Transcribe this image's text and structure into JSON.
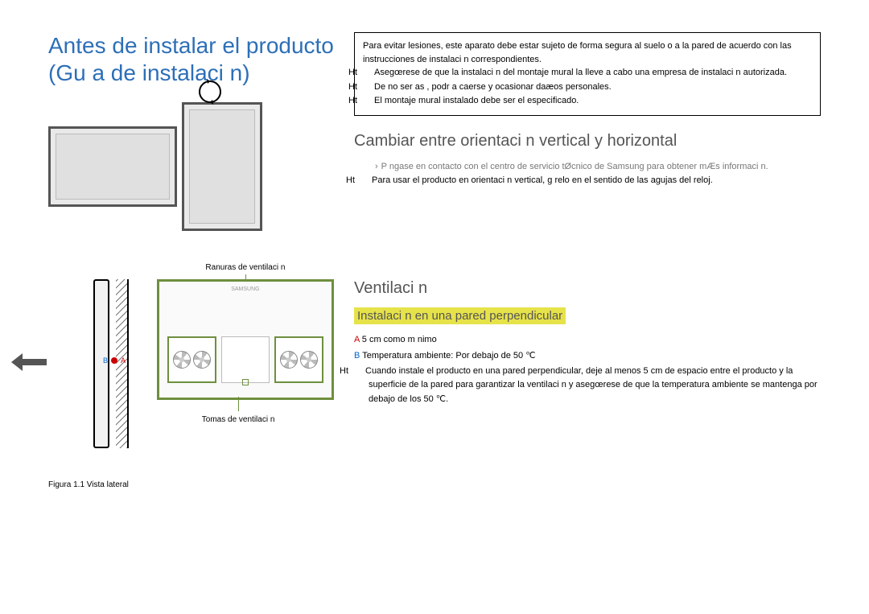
{
  "main_title": "Antes de instalar el producto (Gu a de instalaci n)",
  "warning_box": {
    "intro": "Para evitar lesiones, este aparato debe estar sujeto de forma segura al suelo o a la pared de acuerdo con las instrucciones de instalaci n correspondientes.",
    "bullets": [
      "Asegœrese de que la instalaci n del montaje mural la lleve a cabo una empresa de instalaci n autorizada.",
      "De no ser as , podr a caerse y ocasionar daæos personales.",
      "El montaje mural instalado debe ser el especificado."
    ]
  },
  "orientation": {
    "title": "Cambiar entre orientaci n vertical y horizontal",
    "sub": "P ngase en contacto con el centro de servicio tØcnico de Samsung para obtener mÆs informaci n.",
    "bullet": "Para usar el producto en orientaci n vertical, g relo en el sentido de las agujas del reloj."
  },
  "ventilation": {
    "title": "Ventilaci n",
    "subtitle": "Instalaci n en una pared perpendicular",
    "line_a_label": "A",
    "line_a_text": " 5 cm como m nimo",
    "line_b_label": "B",
    "line_b_text": " Temperatura ambiente: Por debajo de 50 ℃",
    "note": "Cuando instale el producto en una pared perpendicular, deje al menos 5 cm de espacio entre el producto y la superficie de la pared para garantizar la ventilaci n y asegœrese de que la temperatura ambiente se mantenga por debajo de los 50 ℃."
  },
  "figure": {
    "top_label": "Ranuras de ventilaci n",
    "bottom_label": "Tomas de ventilaci n",
    "caption": "Figura 1.1 Vista lateral",
    "a": "A",
    "b": "B",
    "brand": "SAMSUNG"
  }
}
